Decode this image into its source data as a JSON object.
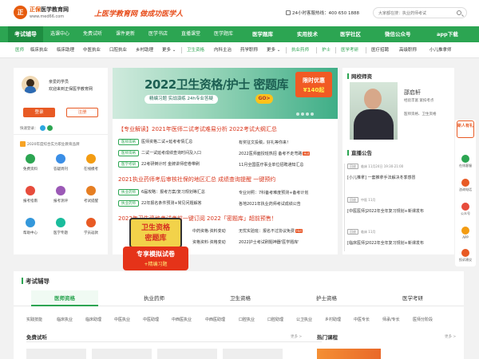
{
  "header": {
    "logo_mark": "正",
    "logo_name": "正保",
    "logo_site": "医学教育网",
    "logo_url": "www.med66.com",
    "slogan": "上医学教育网  做成功医学人",
    "hotline": "24小时客服热线：400 650 1888",
    "search_placeholder": "大家都在搜：执业药师考试"
  },
  "nav": {
    "items": [
      "考试辅导",
      "选课中心",
      "免费试听",
      "课件更新",
      "医学书店",
      "直播课堂",
      "医学题库",
      "医学题库",
      "实用技术",
      "医学社区",
      "微信公众号",
      "app下载"
    ],
    "accent": "#2ca552"
  },
  "subnav": {
    "group1_label": "医师",
    "group1": [
      "临床执业",
      "临床助理",
      "中医执业",
      "口腔执业",
      "乡村助理",
      "更多 ⌄"
    ],
    "group2_label": "卫生资格",
    "group2": [
      "内科主治",
      "药学职称",
      "更多 ⌄"
    ],
    "group3": [
      "执业药师",
      "护士",
      "医学考研"
    ],
    "group4": [
      "医疗招聘",
      "高级职称",
      "小儿推拿师"
    ]
  },
  "user_panel": {
    "greet1": "亲爱的学员",
    "greet2": "欢迎来到正保医学教育网",
    "login": "登录",
    "register": "注册",
    "quick_login": "快速登录：",
    "brand_note": "2020年度综合实力职业教育品牌",
    "grid": [
      {
        "label": "免费资料",
        "color": "#2ca552"
      },
      {
        "label": "答疑周刊",
        "color": "#3a8ee6"
      },
      {
        "label": "在线模考",
        "color": "#f39c12"
      },
      {
        "label": "报考指南",
        "color": "#e74c3c"
      },
      {
        "label": "报考测评",
        "color": "#9b59b6"
      },
      {
        "label": "考试提醒",
        "color": "#e67e22"
      },
      {
        "label": "帮助中心",
        "color": "#3498db"
      },
      {
        "label": "医学专题",
        "color": "#1abc9c"
      },
      {
        "label": "学员返款",
        "color": "#e85a24"
      }
    ]
  },
  "banner": {
    "title": "2022卫生资格/护士 密题库",
    "sub": "精编习题  实战演练  24h专业答疑",
    "go": "GO>",
    "badge1": "限时优惠",
    "badge2": "¥140起"
  },
  "news": {
    "headline1": "【专业解读】2021年医师二试考试难易分析    2022考试大纲汇总",
    "row1_tag": "医师资格",
    "row1": "医师资格二试+延考考情汇总",
    "row1_b": "有奖征文投稿，好礼等你来！",
    "row2_tag": "医师资格",
    "row2": "二试一试延考成绩查询时间及入口",
    "row2_b": "2022医师面授班热招 备考不走弯路",
    "row3_tag": "医学考研",
    "row3": "22考研倒计时 金牌讲师密卷带刷",
    "row3_b": "11月全国医疗事业单位招聘通知汇总",
    "headline2": "2021执业药师考后审核社保的地区汇总   成绩查询提醒 一键预约",
    "row4_tag": "执业药师",
    "row4": "6届攻略：报考方案/复习规划等汇总",
    "row4_b": "专业对照：7科备考难度预测+备考计划",
    "row5_tag": "执业药师",
    "row5": "22年报名条件预测+常见问题解答",
    "row5_b": "各地2021年执业药师考试成绩公告",
    "headline3": "2022年卫生资格考试考前一键订阅   2022「密题库」超前预售！",
    "row6": "中药资格·资料变动",
    "row6_b": "无忧实验班：报名不过协议免费",
    "row7": "资格资料·资格变动",
    "row7_b": "2022护士考试刷题神器'医学题库'"
  },
  "promo": {
    "line1": "卫生资格",
    "line2": "密题库",
    "line3": "专享模拟试卷",
    "line4": "+精编习题"
  },
  "teachers": {
    "title": "网校师资",
    "name": "邵启轩",
    "role": "经验丰富 紧扣考点",
    "desc": "医师资格、卫生资格"
  },
  "live": {
    "title": "直播公告",
    "items": [
      {
        "tag": "回放",
        "meta": "临床  11月24日 19:30-21:00",
        "text": "[小儿推拿] 一套推拿手法解决冬季感冒"
      },
      {
        "tag": "回放",
        "meta": "中医  11月",
        "text": "[中医医师]2022年全年复习规划+新课发布"
      },
      {
        "tag": "回放",
        "meta": "临床  11月",
        "text": "[临床医师]2022年全年复习规划+新课发布"
      }
    ]
  },
  "float_bar": {
    "newbie": "新人有礼",
    "items": [
      "在线客服",
      "咨询电话",
      "公众号",
      "APP",
      "投诉建议"
    ]
  },
  "exam": {
    "title": "考试辅导",
    "tabs": [
      "医师资格",
      "执业药师",
      "卫生资格",
      "护士资格",
      "医学考研"
    ],
    "subs": [
      "实践技能",
      "临床执业",
      "临床助理",
      "中医执业",
      "中医助理",
      "中西医执业",
      "中西医助理",
      "口腔执业",
      "口腔助理",
      "公卫执业",
      "乡村助理",
      "中医专长",
      "师承/专长",
      "医师分阶段"
    ],
    "free_title": "免费试听",
    "hot_title": "热门课程",
    "more": "更多 >"
  }
}
